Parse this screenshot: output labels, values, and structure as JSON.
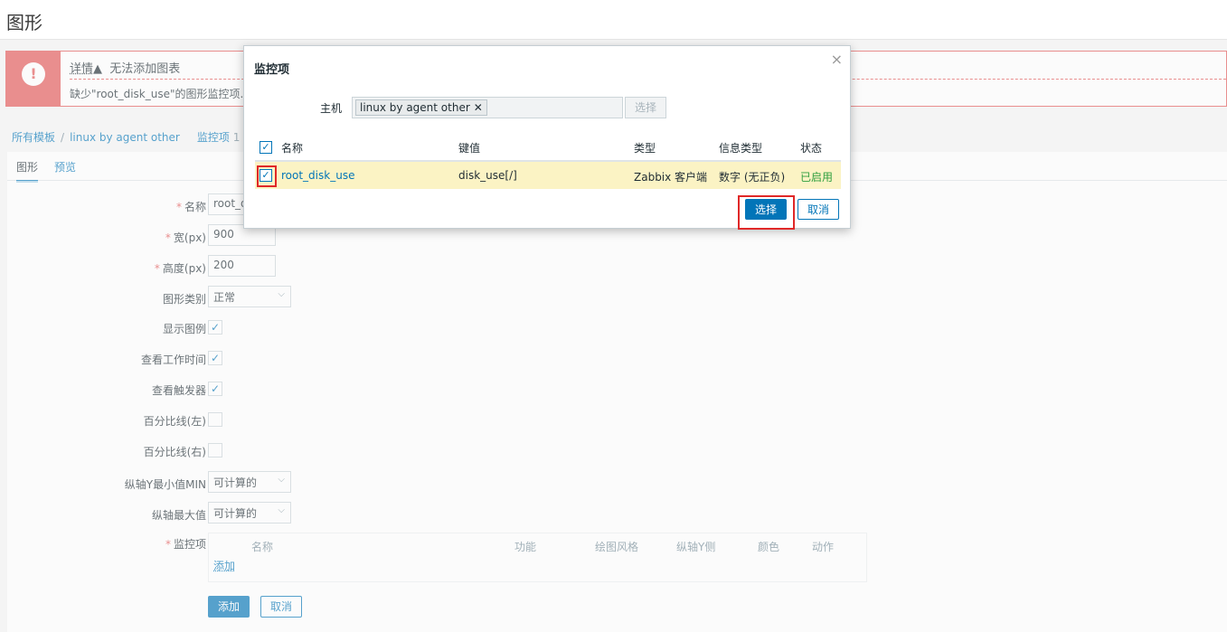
{
  "page": {
    "title": "图形"
  },
  "alert": {
    "details_label": "详情",
    "details_arrow": "▲",
    "title": "无法添加图表",
    "message": "缺少\"root_disk_use\"的图形监控项."
  },
  "breadcrumb": {
    "all_templates": "所有模板",
    "separator": "/",
    "template": "linux by agent other",
    "items_label": "监控项",
    "items_count": "1"
  },
  "tabs": [
    {
      "label": "图形"
    },
    {
      "label": "预览"
    }
  ],
  "form": {
    "name_label": "名称",
    "name_value": "root_d",
    "width_label": "宽(px)",
    "width_value": "900",
    "height_label": "高度(px)",
    "height_value": "200",
    "graph_type_label": "图形类别",
    "graph_type_value": "正常",
    "show_legend_label": "显示图例",
    "show_work_period_label": "查看工作时间",
    "show_triggers_label": "查看触发器",
    "percentile_left_label": "百分比线(左)",
    "percentile_right_label": "百分比线(右)",
    "ymin_label": "纵轴Y最小值MIN",
    "ymin_value": "可计算的",
    "ymax_label": "纵轴最大值",
    "ymax_value": "可计算的",
    "items_label": "监控项",
    "checkmark": "✓"
  },
  "items_table": {
    "headers": [
      "名称",
      "功能",
      "绘图风格",
      "纵轴Y侧",
      "颜色",
      "动作"
    ],
    "add_link": "添加"
  },
  "form_buttons": {
    "add": "添加",
    "cancel": "取消"
  },
  "modal": {
    "title": "监控项",
    "close": "×",
    "host_label": "主机",
    "host_chip": "linux by agent other",
    "host_chip_remove": "✕",
    "host_select_button": "选择",
    "columns": [
      "名称",
      "键值",
      "类型",
      "信息类型",
      "状态"
    ],
    "rows": [
      {
        "name": "root_disk_use",
        "key": "disk_use[/]",
        "type": "Zabbix 客户端",
        "info_type": "数字 (无正负)",
        "status": "已启用"
      }
    ],
    "select_button": "选择",
    "cancel_button": "取消"
  },
  "colors": {
    "accent": "#0275b8",
    "error": "#e45959",
    "highlight_row": "#fbf3c4",
    "status_enabled": "#2f9f3f",
    "annotation_box": "#e02828"
  }
}
